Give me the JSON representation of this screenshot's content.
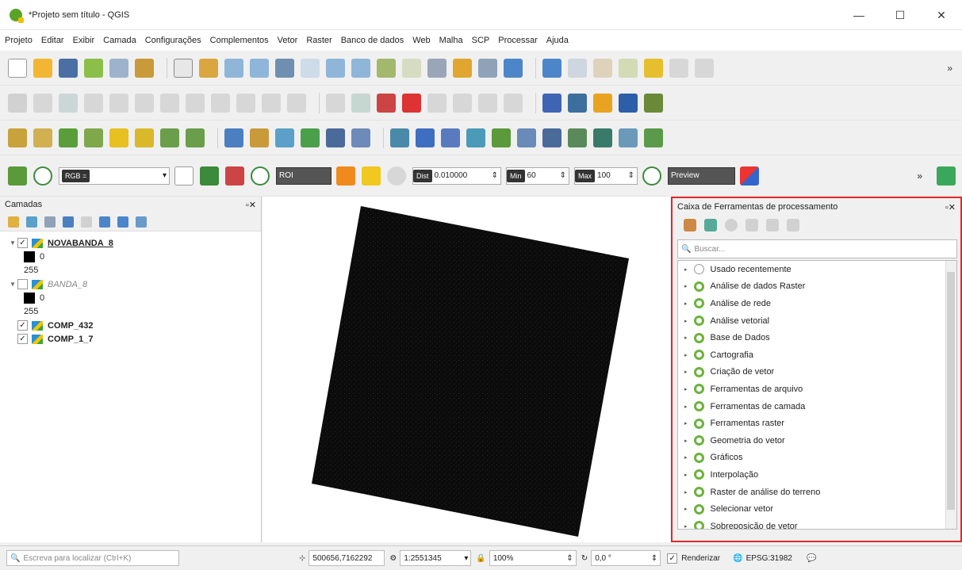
{
  "window": {
    "title": "*Projeto sem título - QGIS",
    "min": "—",
    "max": "☐",
    "close": "✕"
  },
  "menu": [
    "Projeto",
    "Editar",
    "Exibir",
    "Camada",
    "Configurações",
    "Complementos",
    "Vetor",
    "Raster",
    "Banco de dados",
    "Web",
    "Malha",
    "SCP",
    "Processar",
    "Ajuda"
  ],
  "toolbar4": {
    "rgb": "RGB =",
    "roi": "ROI",
    "dist_label": "Dist",
    "dist_value": "0.010000",
    "min_label": "Min",
    "min_value": "60",
    "max_label": "Max",
    "max_value": "100",
    "preview": "Preview",
    "more": "»"
  },
  "layers": {
    "title": "Camadas",
    "items": [
      {
        "name": "NOVABANDA_8",
        "checked": "✓",
        "arrow": "▼",
        "min": "0",
        "max": "255"
      },
      {
        "name": "BANDA_8",
        "checked": "",
        "arrow": "▼",
        "min": "0",
        "max": "255"
      },
      {
        "name": "COMP_432",
        "checked": "✓"
      },
      {
        "name": "COMP_1_7",
        "checked": "✓"
      }
    ]
  },
  "processing": {
    "title": "Caixa de Ferramentas de processamento",
    "search_placeholder": "Buscar...",
    "items": [
      "Usado recentemente",
      "Análise de dados Raster",
      "Análise de rede",
      "Análise vetorial",
      "Base de Dados",
      "Cartografia",
      "Criação de vetor",
      "Ferramentas de arquivo",
      "Ferramentas de camada",
      "Ferramentas raster",
      "Geometria do vetor",
      "Gráficos",
      "Interpolação",
      "Raster de análise do terreno",
      "Selecionar vetor",
      "Sobreposição de vetor"
    ]
  },
  "status": {
    "locator": "Escreva para localizar (Ctrl+K)",
    "coord": "500656,7162292",
    "scale": "1:2551345",
    "magnifier": "100%",
    "rotation": "0,0 °",
    "render": "Renderizar",
    "crs": "EPSG:31982"
  }
}
